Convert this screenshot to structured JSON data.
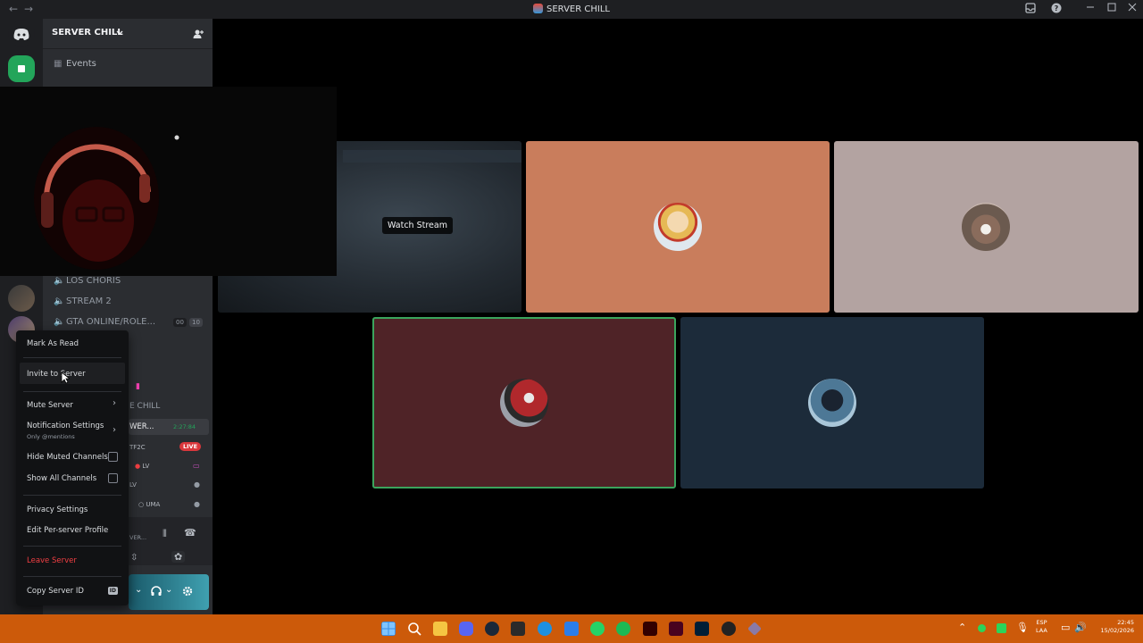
{
  "window": {
    "title": "SERVER CHILL",
    "nav_back": "←",
    "nav_forward": "→"
  },
  "server": {
    "name": "SERVER CHILL",
    "events_label": "Events"
  },
  "channels": [
    {
      "name": "LOS CHORIS"
    },
    {
      "name": "STREAM 2"
    },
    {
      "name": "GTA ONLINE/ROLE...",
      "count_left": "00",
      "count_right": "10"
    }
  ],
  "partial_texts": {
    "chill": "E CHILL",
    "voice_channel": "WER...",
    "voice_timer": "2:27:84",
    "live_badge": "LIVE",
    "tf2c": "TF2C",
    "lv_1": "LV",
    "lv_2": "LV",
    "uma": "UMA",
    "voice_connected": "VER..."
  },
  "stage": {
    "watch_stream_label": "Watch Stream"
  },
  "context_menu": {
    "mark_as_read": "Mark As Read",
    "invite": "Invite to Server",
    "mute_server": "Mute Server",
    "notification_settings": "Notification Settings",
    "notification_subtitle": "Only @mentions",
    "hide_muted": "Hide Muted Channels",
    "show_all": "Show All Channels",
    "privacy": "Privacy Settings",
    "edit_profile": "Edit Per-server Profile",
    "leave": "Leave Server",
    "copy_id": "Copy Server ID",
    "id_badge": "ID"
  },
  "taskbar": {
    "lang_top": "ESP",
    "lang_bottom": "LAA",
    "time": "22:45",
    "date": "15/02/2026"
  },
  "colors": {
    "tile_orange": "#c97d5c",
    "tile_grey": "#b3a3a1",
    "tile_red": "#4f2327",
    "tile_navy": "#1c2b3a",
    "speaking_border": "#3ba55d",
    "taskbar": "#cc5a0a",
    "leave_red": "#f23f43"
  }
}
